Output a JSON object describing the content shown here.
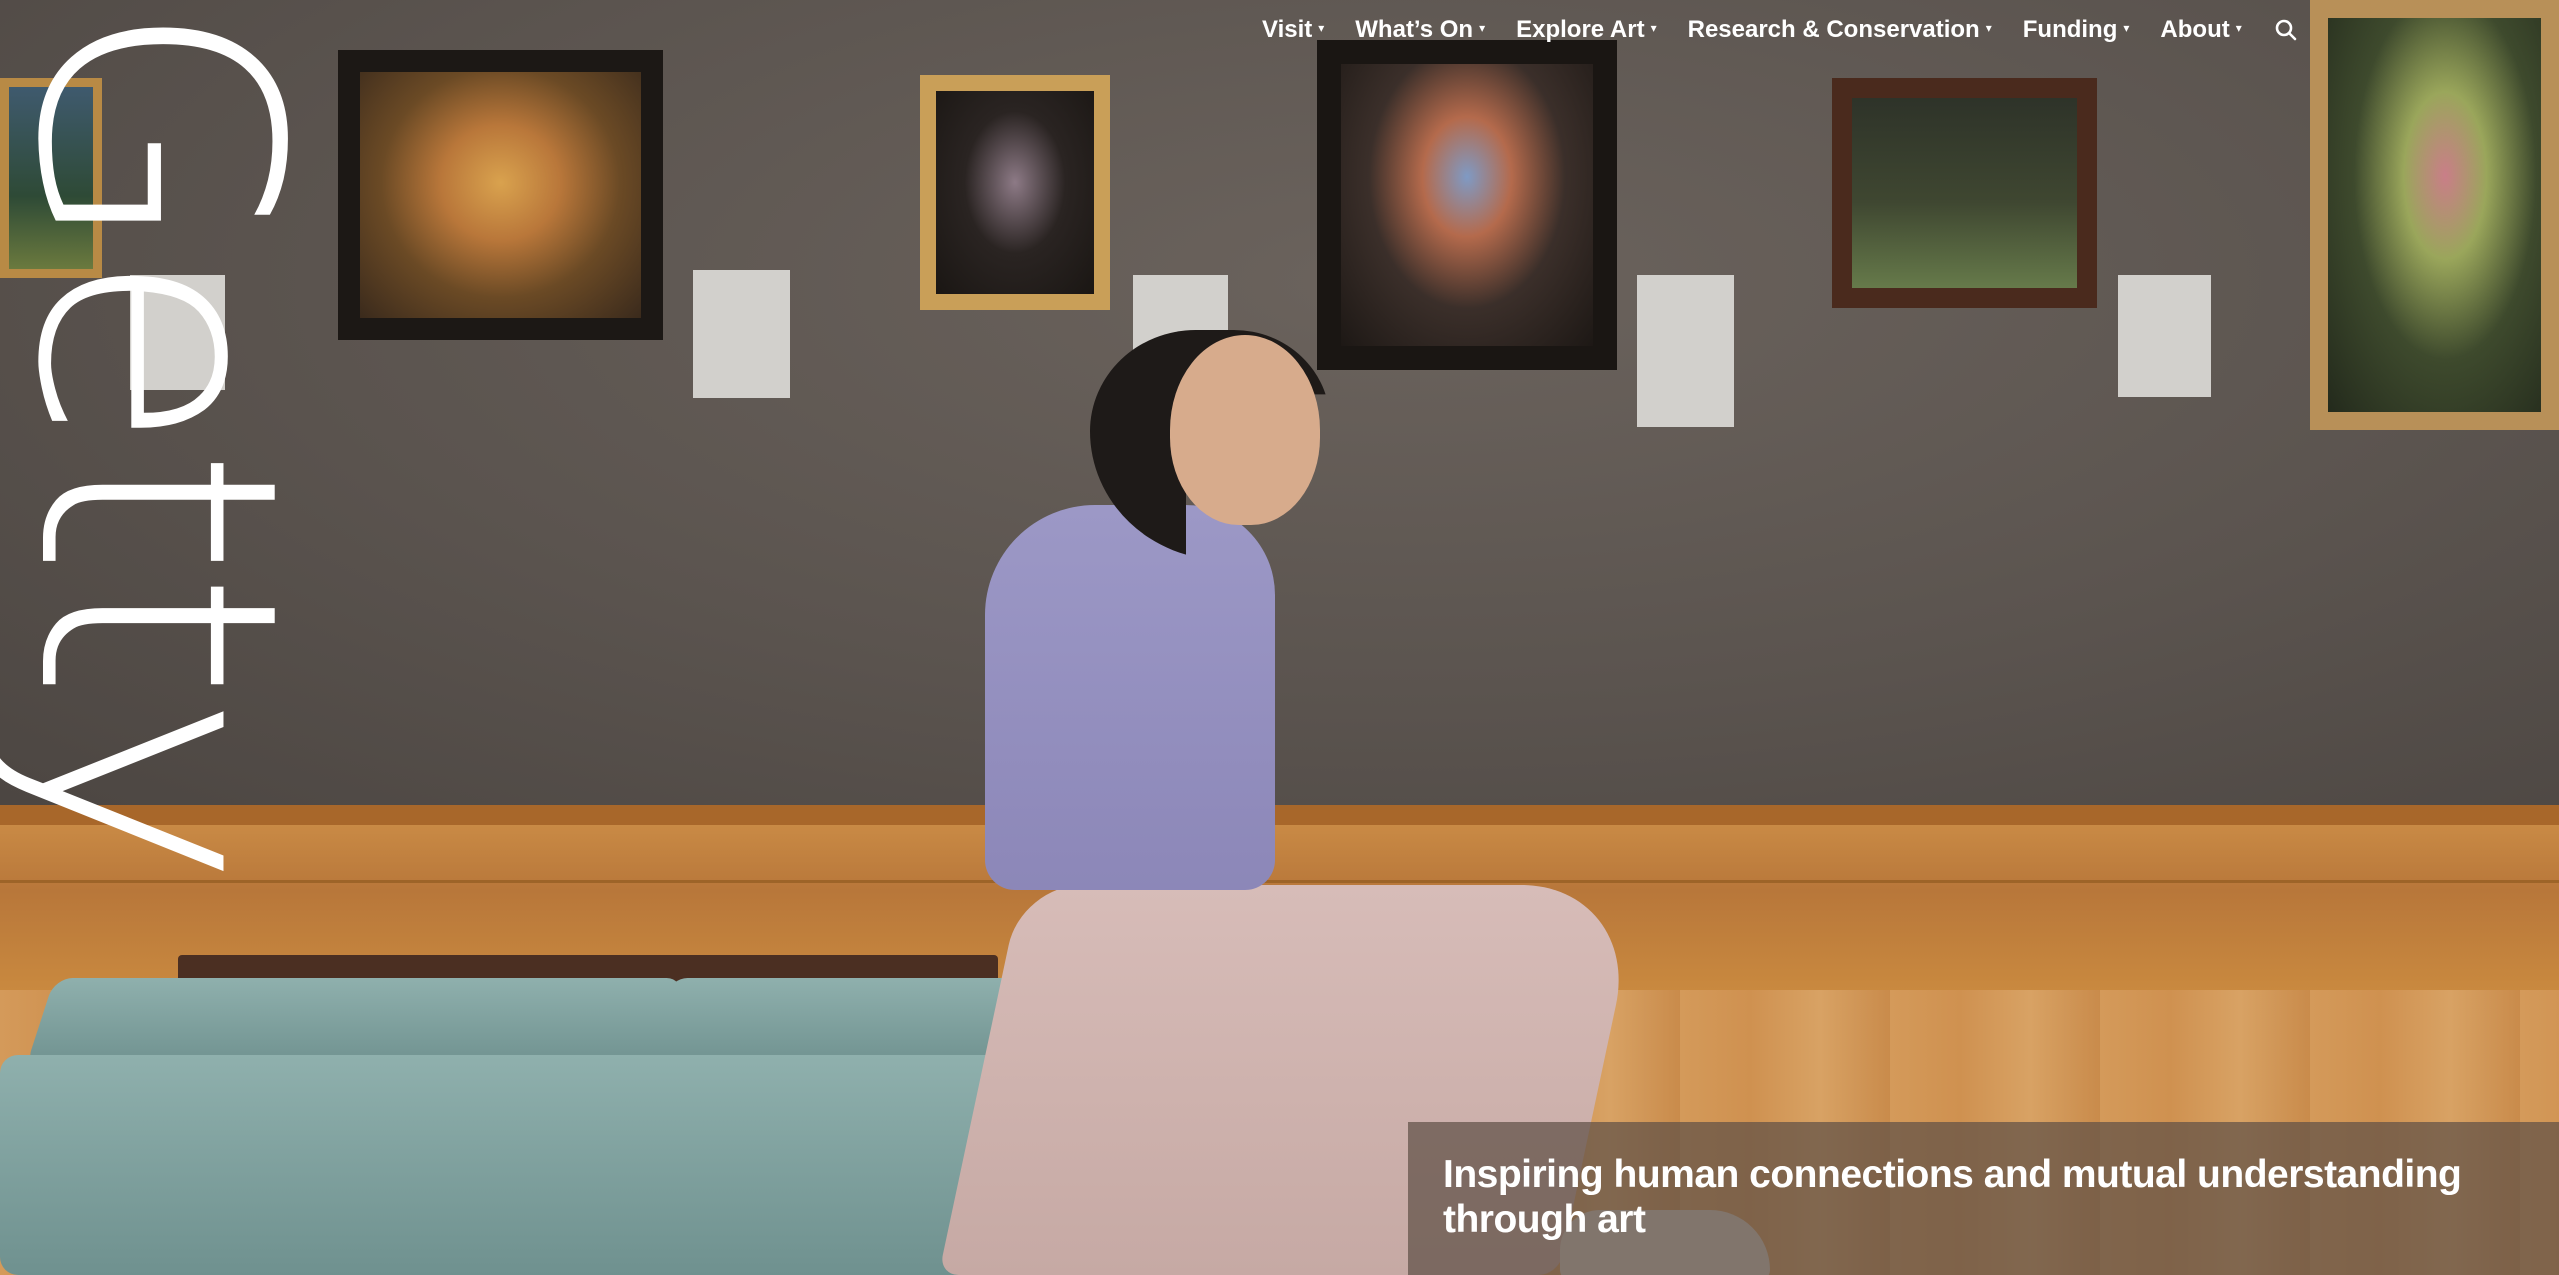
{
  "brand": {
    "logo_text": "Getty"
  },
  "nav": {
    "items": [
      {
        "label": "Visit"
      },
      {
        "label": "What’s On"
      },
      {
        "label": "Explore Art"
      },
      {
        "label": "Research & Conservation"
      },
      {
        "label": "Funding"
      },
      {
        "label": "About"
      }
    ],
    "caret_glyph": "▾",
    "search_icon": "search-icon"
  },
  "hero": {
    "caption": "Inspiring human connections and mutual understanding through art"
  },
  "colors": {
    "text": "#ffffff",
    "wall": "#5b544f",
    "wood": "#c98a45",
    "caption_bg": "rgba(95,80,70,0.72)"
  }
}
